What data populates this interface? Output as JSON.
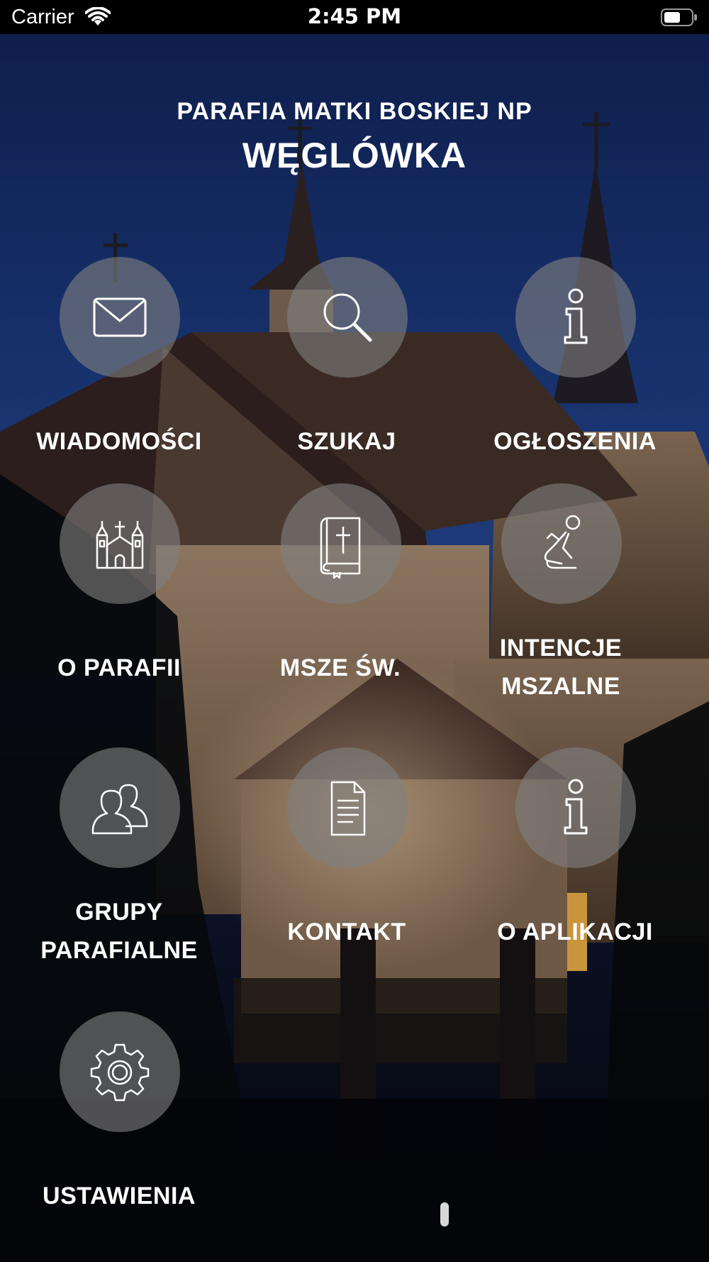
{
  "status_bar": {
    "carrier": "Carrier",
    "time": "2:45 PM",
    "wifi_icon": "wifi-icon",
    "battery_icon": "battery-icon"
  },
  "header": {
    "subtitle": "PARAFIA MATKI BOSKIEJ NP",
    "title": "WĘGLÓWKA"
  },
  "menu": {
    "items": [
      {
        "label": "WIADOMOŚCI",
        "icon": "envelope-icon"
      },
      {
        "label": "SZUKAJ",
        "icon": "search-icon"
      },
      {
        "label": "OGŁOSZENIA",
        "icon": "info-icon"
      },
      {
        "label": "O PARAFII",
        "icon": "church-icon"
      },
      {
        "label": "MSZE ŚW.",
        "icon": "bible-icon"
      },
      {
        "label": "INTENCJE\nMSZALNE",
        "icon": "praying-person-icon"
      },
      {
        "label": "GRUPY\nPARAFIALNE",
        "icon": "people-group-icon"
      },
      {
        "label": "KONTAKT",
        "icon": "document-icon"
      },
      {
        "label": "O APLIKACJI",
        "icon": "info-icon"
      },
      {
        "label": "USTAWIENIA",
        "icon": "gear-icon"
      }
    ]
  },
  "colors": {
    "sky": "#13295e",
    "tile_circle": "#808080",
    "text": "#ffffff"
  }
}
